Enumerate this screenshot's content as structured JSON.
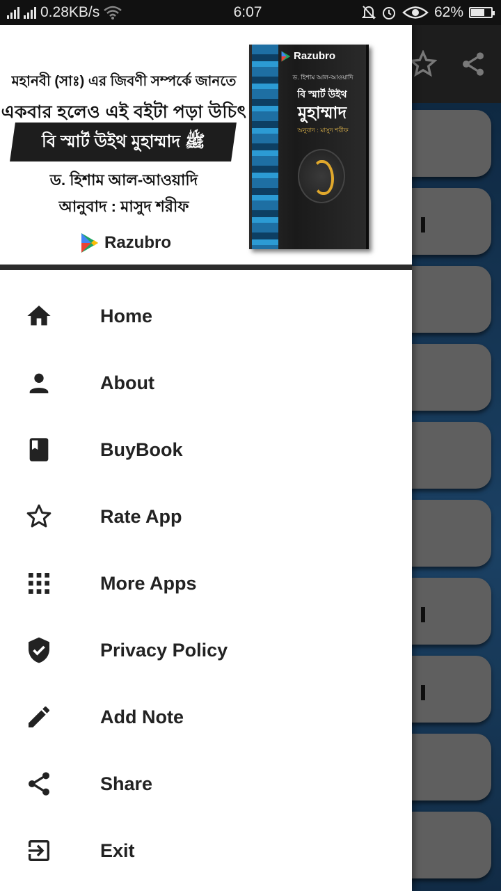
{
  "status_bar": {
    "network_speed": "0.28KB/s",
    "time": "6:07",
    "battery_percent": "62%",
    "battery_level": 0.62
  },
  "header": {
    "promo_line1": "মহানবী (সাঃ) এর জিবণী সম্পর্কে জানতে",
    "promo_line2": "একবার হলেও এই বইটা পড়া উচিৎ",
    "promo_title": "বি স্মার্ট উইথ মুহাম্মাদ ﷺ",
    "promo_author": "ড. হিশাম আল-আওয়াদি",
    "promo_translator": "আনুবাদ : মাসুদ শরীফ",
    "brand": "Razubro",
    "book_brand": "Razubro",
    "book_author": "ড. হিশাম আল-আওয়াদি",
    "book_title_line1": "বি স্মার্ট উইথ",
    "book_title_line2": "মুহাম্মাদ",
    "book_translator": "অনুবাদ : মাসুদ শরীফ"
  },
  "menu": {
    "items": [
      {
        "label": "Home",
        "icon": "home-icon"
      },
      {
        "label": "About",
        "icon": "person-icon"
      },
      {
        "label": "BuyBook",
        "icon": "book-icon"
      },
      {
        "label": "Rate App",
        "icon": "star-outline-icon"
      },
      {
        "label": "More Apps",
        "icon": "apps-grid-icon"
      },
      {
        "label": "Privacy Policy",
        "icon": "shield-check-icon"
      },
      {
        "label": "Add Note",
        "icon": "pencil-icon"
      },
      {
        "label": "Share",
        "icon": "share-icon"
      },
      {
        "label": "Exit",
        "icon": "exit-icon"
      }
    ]
  },
  "colors": {
    "drawer_bg": "#ffffff",
    "icon_color": "#222222",
    "header_divider": "#2c2c2c",
    "background_card": "#6d6d6d"
  }
}
